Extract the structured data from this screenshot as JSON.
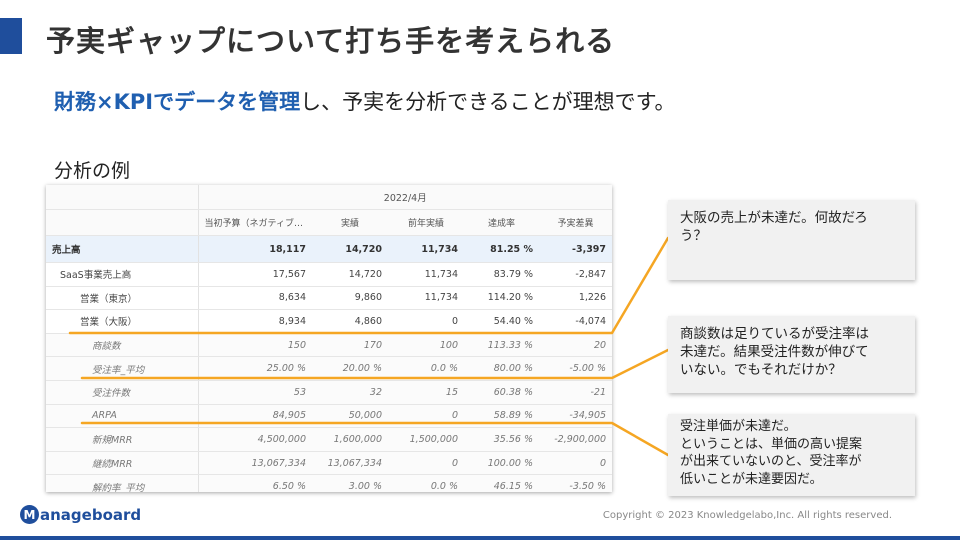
{
  "title": "予実ギャップについて打ち手を考えられる",
  "subtitle": {
    "highlight": "財務×KPIでデータを管理",
    "rest": "し、予実を分析できることが理想です。"
  },
  "example_label": "分析の例",
  "table": {
    "period": "2022/4月",
    "columns": [
      "当初予算（ネガティブ-…",
      "実績",
      "前年実績",
      "達成率",
      "予実差異"
    ],
    "rows": [
      {
        "label": "売上高",
        "values": [
          "18,117",
          "14,720",
          "11,734",
          "81.25 %",
          "-3,397"
        ]
      },
      {
        "label": "SaaS事業売上高",
        "values": [
          "17,567",
          "14,720",
          "11,734",
          "83.79 %",
          "-2,847"
        ]
      },
      {
        "label": "営業（東京）",
        "values": [
          "8,634",
          "9,860",
          "11,734",
          "114.20 %",
          "1,226"
        ]
      },
      {
        "label": "営業（大阪）",
        "values": [
          "8,934",
          "4,860",
          "0",
          "54.40 %",
          "-4,074"
        ]
      },
      {
        "label": "商談数",
        "values": [
          "150",
          "170",
          "100",
          "113.33 %",
          "20"
        ]
      },
      {
        "label": "受注率_平均",
        "values": [
          "25.00 %",
          "20.00 %",
          "0.0 %",
          "80.00 %",
          "-5.00 %"
        ]
      },
      {
        "label": "受注件数",
        "values": [
          "53",
          "32",
          "15",
          "60.38 %",
          "-21"
        ]
      },
      {
        "label": "ARPA",
        "values": [
          "84,905",
          "50,000",
          "0",
          "58.89 %",
          "-34,905"
        ]
      },
      {
        "label": "新規MRR",
        "values": [
          "4,500,000",
          "1,600,000",
          "1,500,000",
          "35.56 %",
          "-2,900,000"
        ]
      },
      {
        "label": "継続MRR",
        "values": [
          "13,067,334",
          "13,067,334",
          "0",
          "100.00 %",
          "0"
        ]
      },
      {
        "label": "解約率_平均",
        "values": [
          "6.50 %",
          "3.00 %",
          "0.0 %",
          "46.15 %",
          "-3.50 %"
        ]
      }
    ]
  },
  "callouts": [
    {
      "lines": [
        "大阪の売上が未達だ。何故だろ",
        "う？"
      ]
    },
    {
      "lines": [
        "商談数は足りているが受注率は",
        "未達だ。結果受注件数が伸びて",
        "いない。でもそれだけか？"
      ]
    },
    {
      "lines": [
        "受注単価が未達だ。",
        "ということは、単価の高い提案",
        "が出来ていないのと、受注率が",
        "低いことが未達要因だ。"
      ]
    }
  ],
  "logo": {
    "mark": "M",
    "text": "anageboard"
  },
  "copyright": "Copyright © 2023 Knowledgelabo,Inc. All rights reserved.",
  "colors": {
    "accent": "#1f4e9c",
    "highlight": "#1f5fb0",
    "leader": "#f5a623"
  }
}
